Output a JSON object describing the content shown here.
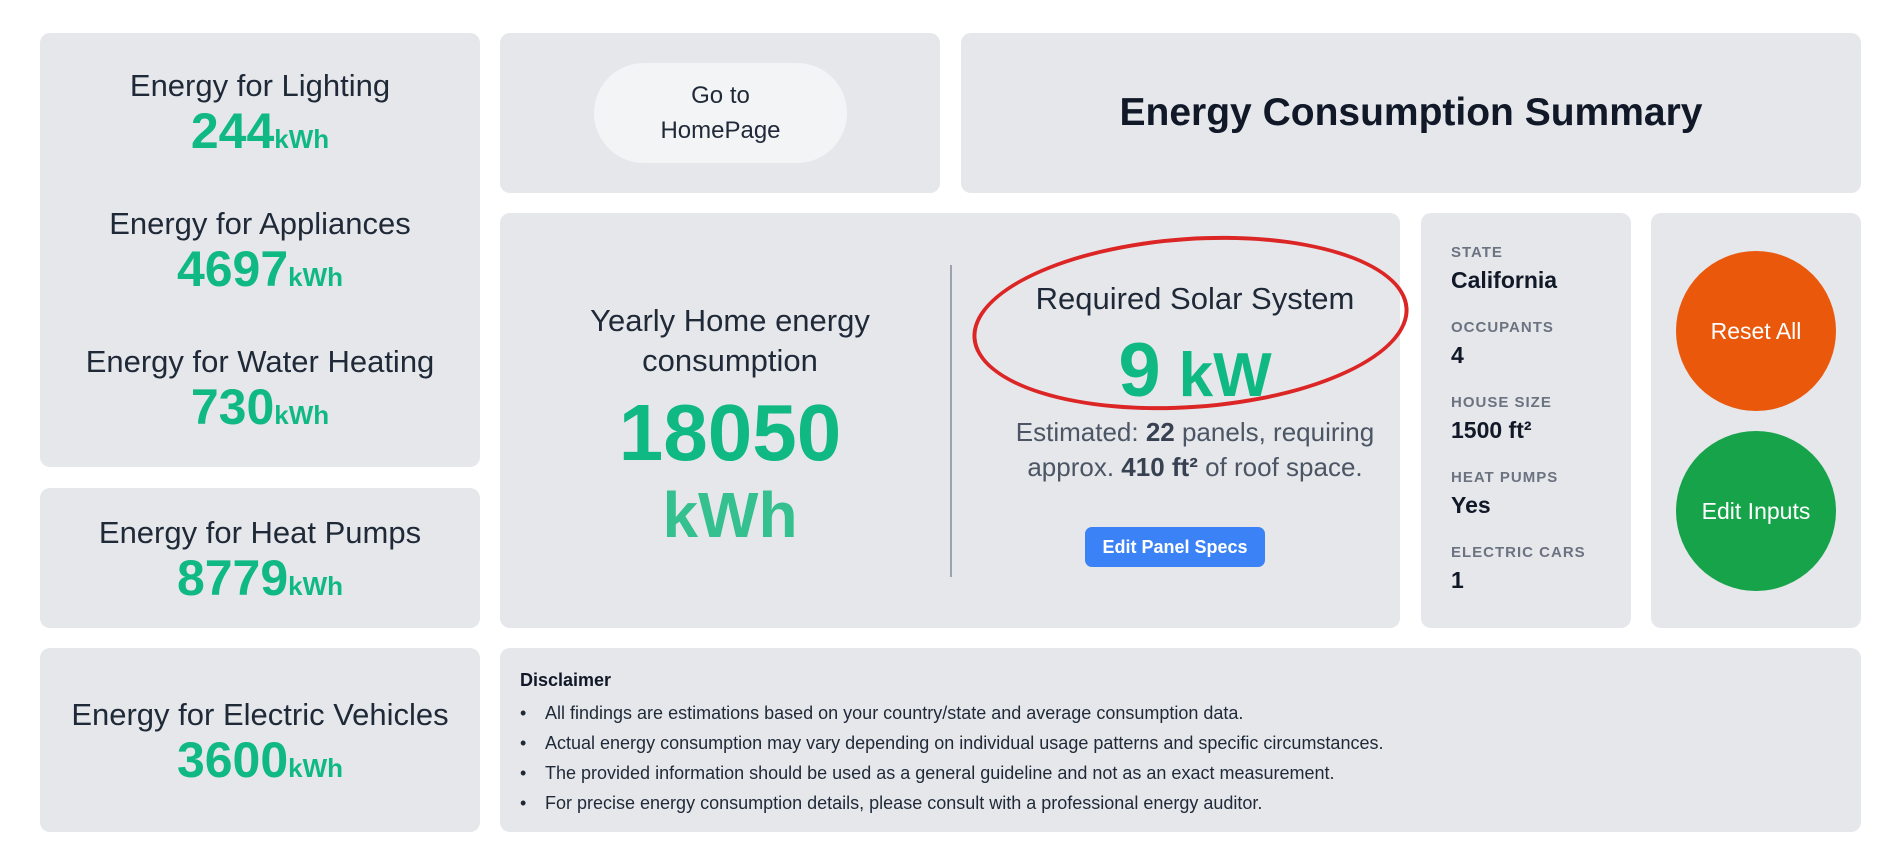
{
  "energy_items": [
    {
      "label": "Energy for Lighting",
      "value": "244",
      "unit": "kWh"
    },
    {
      "label": "Energy for Appliances",
      "value": "4697",
      "unit": "kWh"
    },
    {
      "label": "Energy for Water Heating",
      "value": "730",
      "unit": "kWh"
    },
    {
      "label": "Energy for Heat Pumps",
      "value": "8779",
      "unit": "kWh"
    },
    {
      "label": "Energy for Electric Vehicles",
      "value": "3600",
      "unit": "kWh"
    }
  ],
  "nav": {
    "home_button": "Go to\nHomePage"
  },
  "header": {
    "title": "Energy Consumption Summary"
  },
  "yearly": {
    "label": "Yearly Home energy consumption",
    "value": "18050",
    "unit": "kWh"
  },
  "solar": {
    "title": "Required Solar System",
    "value": "9",
    "unit": "kW",
    "estimate_prefix": "Estimated: ",
    "panels": "22",
    "estimate_mid": " panels, requiring approx. ",
    "roof_space": "410 ft²",
    "estimate_suffix": " of roof space.",
    "edit_button": "Edit Panel Specs"
  },
  "stats": [
    {
      "label": "STATE",
      "value": "California"
    },
    {
      "label": "OCCUPANTS",
      "value": "4"
    },
    {
      "label": "HOUSE SIZE",
      "value": "1500 ft²"
    },
    {
      "label": "HEAT PUMPS",
      "value": "Yes"
    },
    {
      "label": "ELECTRIC CARS",
      "value": "1"
    }
  ],
  "actions": {
    "reset": "Reset All",
    "edit_inputs": "Edit Inputs"
  },
  "colors": {
    "accent_green": "#10b981",
    "reset_orange": "#ea580c",
    "edit_green": "#16a34a",
    "specs_blue": "#3b82f6",
    "highlight_red": "#dc2626"
  },
  "disclaimer": {
    "title": "Disclaimer",
    "items": [
      "All findings are estimations based on your country/state and average consumption data.",
      "Actual energy consumption may vary depending on individual usage patterns and specific circumstances.",
      "The provided information should be used as a general guideline and not as an exact measurement.",
      "For precise energy consumption details, please consult with a professional energy auditor."
    ]
  }
}
